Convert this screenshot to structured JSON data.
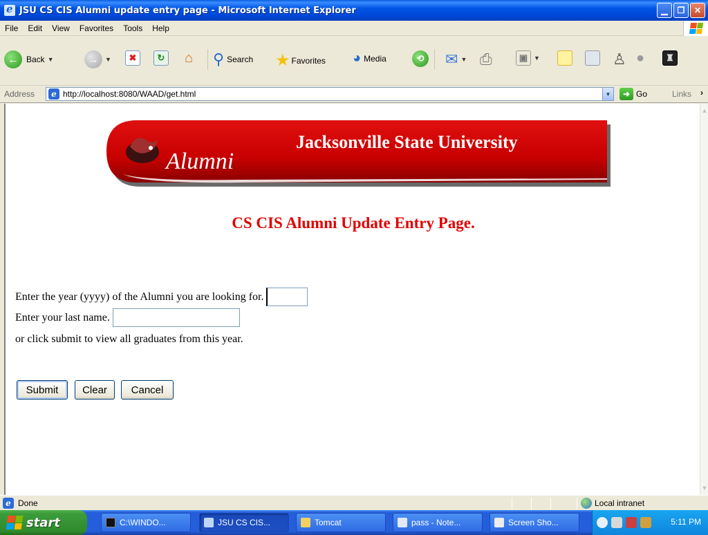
{
  "window": {
    "title": "JSU CS CIS Alumni update entry page - Microsoft Internet Explorer"
  },
  "menu": [
    "File",
    "Edit",
    "View",
    "Favorites",
    "Tools",
    "Help"
  ],
  "toolbar": {
    "back_label": "Back",
    "search_label": "Search",
    "favorites_label": "Favorites",
    "media_label": "Media"
  },
  "address": {
    "label": "Address",
    "url": "http://localhost:8080/WAAD/get.html",
    "go_label": "Go",
    "links_label": "Links"
  },
  "page": {
    "banner_left": "Alumni",
    "banner_right": "Jacksonville State University",
    "heading": "CS CIS Alumni Update Entry Page.",
    "year_prompt": "Enter the year (yyyy) of the Alumni you are looking for.",
    "year_value": "",
    "lastname_prompt": "Enter your last name.",
    "lastname_value": "",
    "hint": "or click submit to view all graduates from this year.",
    "submit_label": "Submit",
    "clear_label": "Clear",
    "cancel_label": "Cancel"
  },
  "status": {
    "text": "Done",
    "zone": "Local intranet"
  },
  "taskbar": {
    "start_label": "start",
    "tasks": [
      {
        "label": "C:\\WINDO..."
      },
      {
        "label": "JSU CS CIS..."
      },
      {
        "label": "Tomcat"
      },
      {
        "label": "pass - Note..."
      },
      {
        "label": "Screen Sho..."
      }
    ],
    "clock": "5:11 PM"
  },
  "colors": {
    "heading": "#e00000",
    "banner_red": "#d40000",
    "xp_blue": "#245edb",
    "start_green": "#3c9c3a"
  }
}
